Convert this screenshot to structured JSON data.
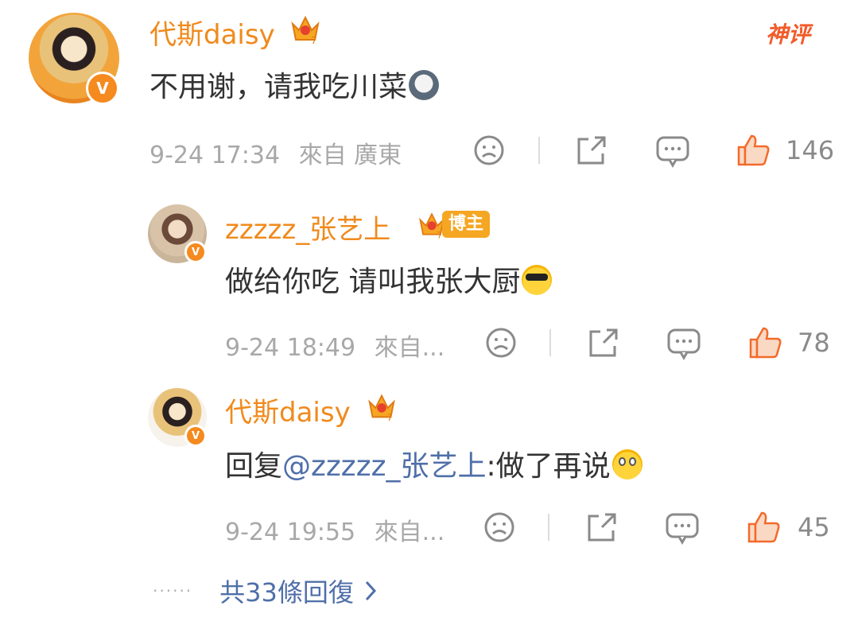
{
  "badge_text": "神评",
  "comments": [
    {
      "username": "代斯daisy",
      "crown_level": "7",
      "text": "不用谢，请我吃川菜",
      "emoji": "dog-tongue-emoji",
      "date": "9-24 17:34",
      "source": "來自 廣東",
      "likes": "146"
    },
    {
      "username": "zzzzz_张艺上",
      "crown_level": "7",
      "role_badge": "博主",
      "text": "做给你吃 请叫我张大厨",
      "emoji": "sunglasses-emoji",
      "date": "9-24 18:49",
      "source": "來自...",
      "likes": "78"
    },
    {
      "username": "代斯daisy",
      "crown_level": "7",
      "text_prefix": "回复",
      "mention": "@zzzzz_张艺上",
      "text_suffix": ":做了再说",
      "emoji": "flushed-emoji",
      "date": "9-24 19:55",
      "source": "來自...",
      "likes": "45"
    }
  ],
  "more_replies": "共33條回復",
  "colors": {
    "accent": "#f08a1c",
    "link": "#4f6fa8",
    "meta": "#a8a8a8",
    "badge": "#f35b2a"
  }
}
